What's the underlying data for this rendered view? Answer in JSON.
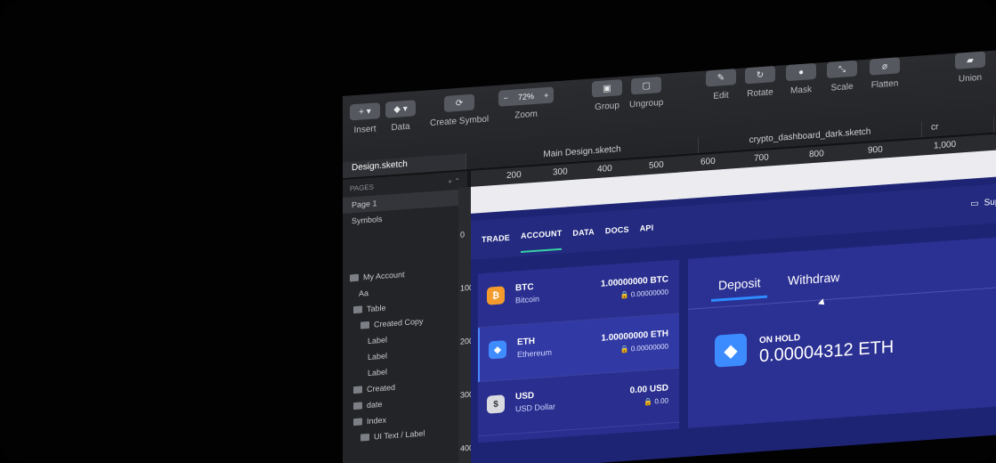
{
  "toolbar": {
    "insert_label": "Insert",
    "data_label": "Data",
    "create_symbol_label": "Create Symbol",
    "zoom_value": "72%",
    "zoom_label": "Zoom",
    "group_label": "Group",
    "ungroup_label": "Ungroup",
    "edit_label": "Edit",
    "rotate_label": "Rotate",
    "mask_label": "Mask",
    "scale_label": "Scale",
    "flatten_label": "Flatten",
    "union_label": "Union"
  },
  "tabs": {
    "t1": "Design.sketch",
    "t2": "Main Design.sketch",
    "t3": "crypto_dashboard_dark.sketch",
    "t4": "cr"
  },
  "sidebar": {
    "pages_title": "PAGES",
    "page1": "Page 1",
    "symbols": "Symbols",
    "layers": [
      "My Account",
      "Aa",
      "Table",
      "Created Copy",
      "Label",
      "Label",
      "Label",
      "Created",
      "date",
      "Index",
      "UI Text / Label"
    ]
  },
  "rulers": {
    "top": [
      "200",
      "300",
      "400",
      "500",
      "600",
      "700",
      "800",
      "900",
      "1,000"
    ],
    "left": [
      "0",
      "100",
      "200",
      "300",
      "400"
    ]
  },
  "dashboard": {
    "nav": [
      "TRADE",
      "ACCOUNT",
      "DATA",
      "DOCS",
      "API"
    ],
    "support": "Supp",
    "assets": [
      {
        "symbol": "BTC",
        "name": "Bitcoin",
        "balance": "1.00000000 BTC",
        "hold": "0.00000000",
        "color": "#f39c2d"
      },
      {
        "symbol": "ETH",
        "name": "Ethereum",
        "balance": "1.00000000 ETH",
        "hold": "0.00000000",
        "color": "#3f8cff"
      },
      {
        "symbol": "USD",
        "name": "USD Dollar",
        "balance": "0.00 USD",
        "hold": "0.00",
        "color": "#d9dbe1"
      }
    ],
    "panel": {
      "deposit": "Deposit",
      "withdraw": "Withdraw",
      "onhold_label": "ON HOLD",
      "onhold_value": "0.00004312 ETH"
    }
  }
}
